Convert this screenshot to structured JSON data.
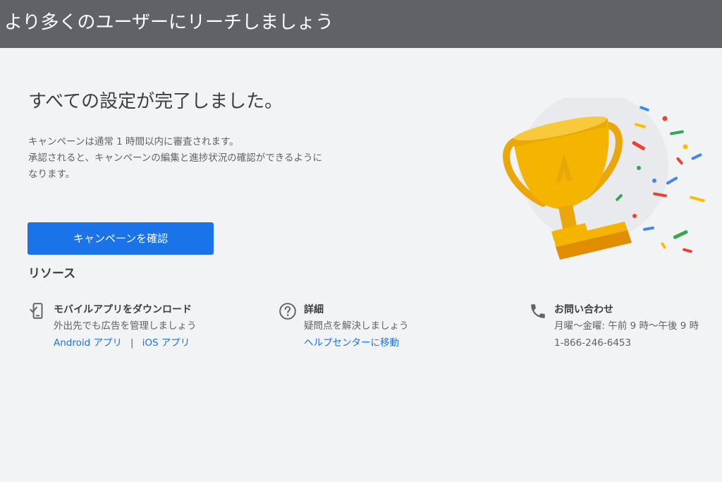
{
  "topbar": {
    "title": "より多くのユーザーにリーチしましょう"
  },
  "main": {
    "headline": "すべての設定が完了しました。",
    "description_lines": [
      "キャンペーンは通常 1 時間以内に審査されます。",
      "承認されると、キャンペーンの編集と進捗状況の確認ができるように",
      "なります。"
    ],
    "primary_button_label": "キャンペーンを確認"
  },
  "resources": {
    "title": "リソース",
    "mobile": {
      "icon": "phone-check-icon",
      "heading": "モバイルアプリをダウンロード",
      "subtext": "外出先でも広告を管理しましょう",
      "android_link": "Android アプリ",
      "separator": "|",
      "ios_link": "iOS アプリ"
    },
    "details": {
      "icon": "help-circle-icon",
      "heading": "詳細",
      "subtext": "疑問点を解決しましょう",
      "help_link": "ヘルプセンターに移動"
    },
    "contact": {
      "icon": "phone-icon",
      "heading": "お問い合わせ",
      "hours": "月曜〜金曜: 午前 9 時〜午後 9 時",
      "phone": "1-866-246-6453"
    }
  },
  "colors": {
    "topbar": "#5f6368",
    "background": "#f1f3f4",
    "primary": "#1a73e8",
    "link": "#1a73e8",
    "trophy_gold": "#f4b400"
  },
  "illustration": {
    "icon": "trophy-confetti-illustration"
  }
}
